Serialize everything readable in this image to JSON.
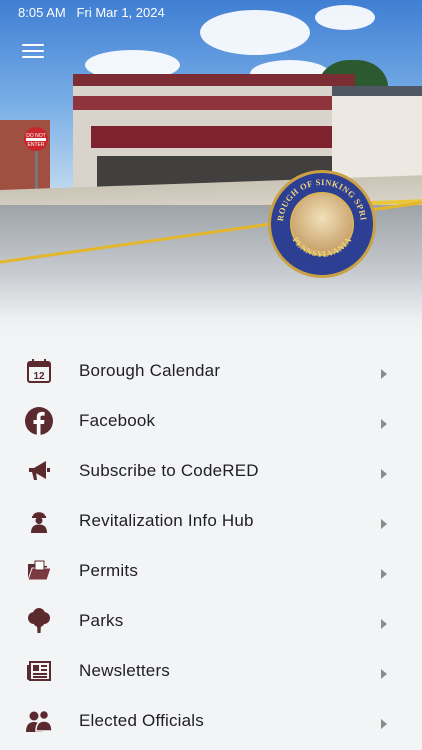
{
  "status_bar": {
    "time": "8:05 AM",
    "date": "Fri Mar 1, 2024"
  },
  "colors": {
    "icon": "#5a2a2e",
    "text": "#1f1f24",
    "chevron": "#8c8c8c",
    "background": "#f3f4f6",
    "seal_blue": "#2d3f93",
    "seal_gold": "#caa243"
  },
  "header": {
    "menu_icon": "hamburger-menu-icon",
    "sign_text": [
      "DO NOT",
      "ENTER"
    ],
    "seal": {
      "top_text": "BOROUGH OF SINKING SPRING",
      "bottom_text": "PENNSYLVANIA"
    }
  },
  "menu": {
    "items": [
      {
        "label": "Borough Calendar",
        "icon": "calendar-icon",
        "icon_text": "12"
      },
      {
        "label": "Facebook",
        "icon": "facebook-icon"
      },
      {
        "label": "Subscribe to CodeRED",
        "icon": "megaphone-icon"
      },
      {
        "label": "Revitalization Info Hub",
        "icon": "worker-icon"
      },
      {
        "label": "Permits",
        "icon": "folder-icon"
      },
      {
        "label": "Parks",
        "icon": "tree-icon"
      },
      {
        "label": "Newsletters",
        "icon": "newspaper-icon"
      },
      {
        "label": "Elected Officials",
        "icon": "officials-icon"
      }
    ]
  }
}
